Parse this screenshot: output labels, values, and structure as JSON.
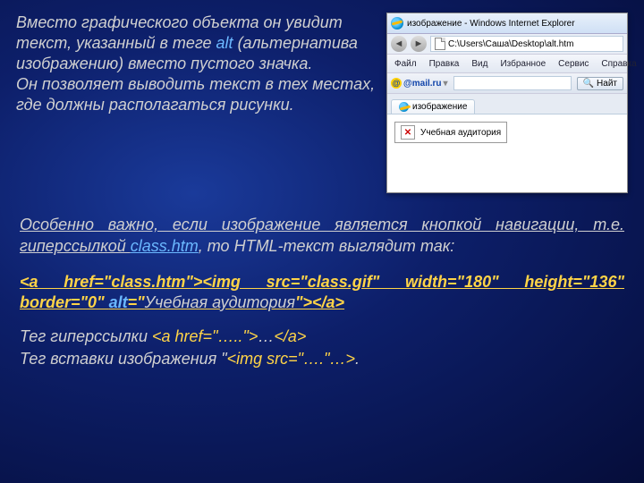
{
  "para1": {
    "line_before_alt": "Вместо графического объекта он увидит текст, указанный в теге ",
    "alt_word": "alt",
    "line_after_alt": " (альтернатива изображению) вместо пустого значка.",
    "line2": "Он позволяет выводить текст в тех местах, где должны располагаться рисунки."
  },
  "browser": {
    "title": "изображение - Windows Internet Explorer",
    "address": "C:\\Users\\Саша\\Desktop\\alt.htm",
    "menu": [
      "Файл",
      "Правка",
      "Вид",
      "Избранное",
      "Сервис",
      "Справка"
    ],
    "mail_label": "@mail.ru",
    "search_btn": "Найт",
    "tab_label": "изображение",
    "alt_text": "Учебная аудитория"
  },
  "para2": {
    "u_part": "Особенно важно, если изображение является кнопкой навигации, т.е. гиперссылкой ",
    "class_htm": "class.htm",
    "after": ", то HTML-текст выглядит так:"
  },
  "code": {
    "aopen": "<a href=\"class.htm\">",
    "imgpart": "<img src=\"class.gif\" width=\"180\" height=\"136\" border=\"0\" ",
    "altkw": "alt",
    "eq": "=\"",
    "alttxt": "Учебная аудитория",
    "endq": "\">",
    "aclose": "</a>"
  },
  "tail": {
    "t1_pre": "Тег гиперссылки ",
    "t1_tag_open": "<a href=\"…..\">",
    "t1_mid": "…",
    "t1_tag_close": "</a>",
    "t2_pre": "Тег вставки изображения \"",
    "t2_tag": "<img src=\"….\"…>",
    "t2_post": "."
  }
}
